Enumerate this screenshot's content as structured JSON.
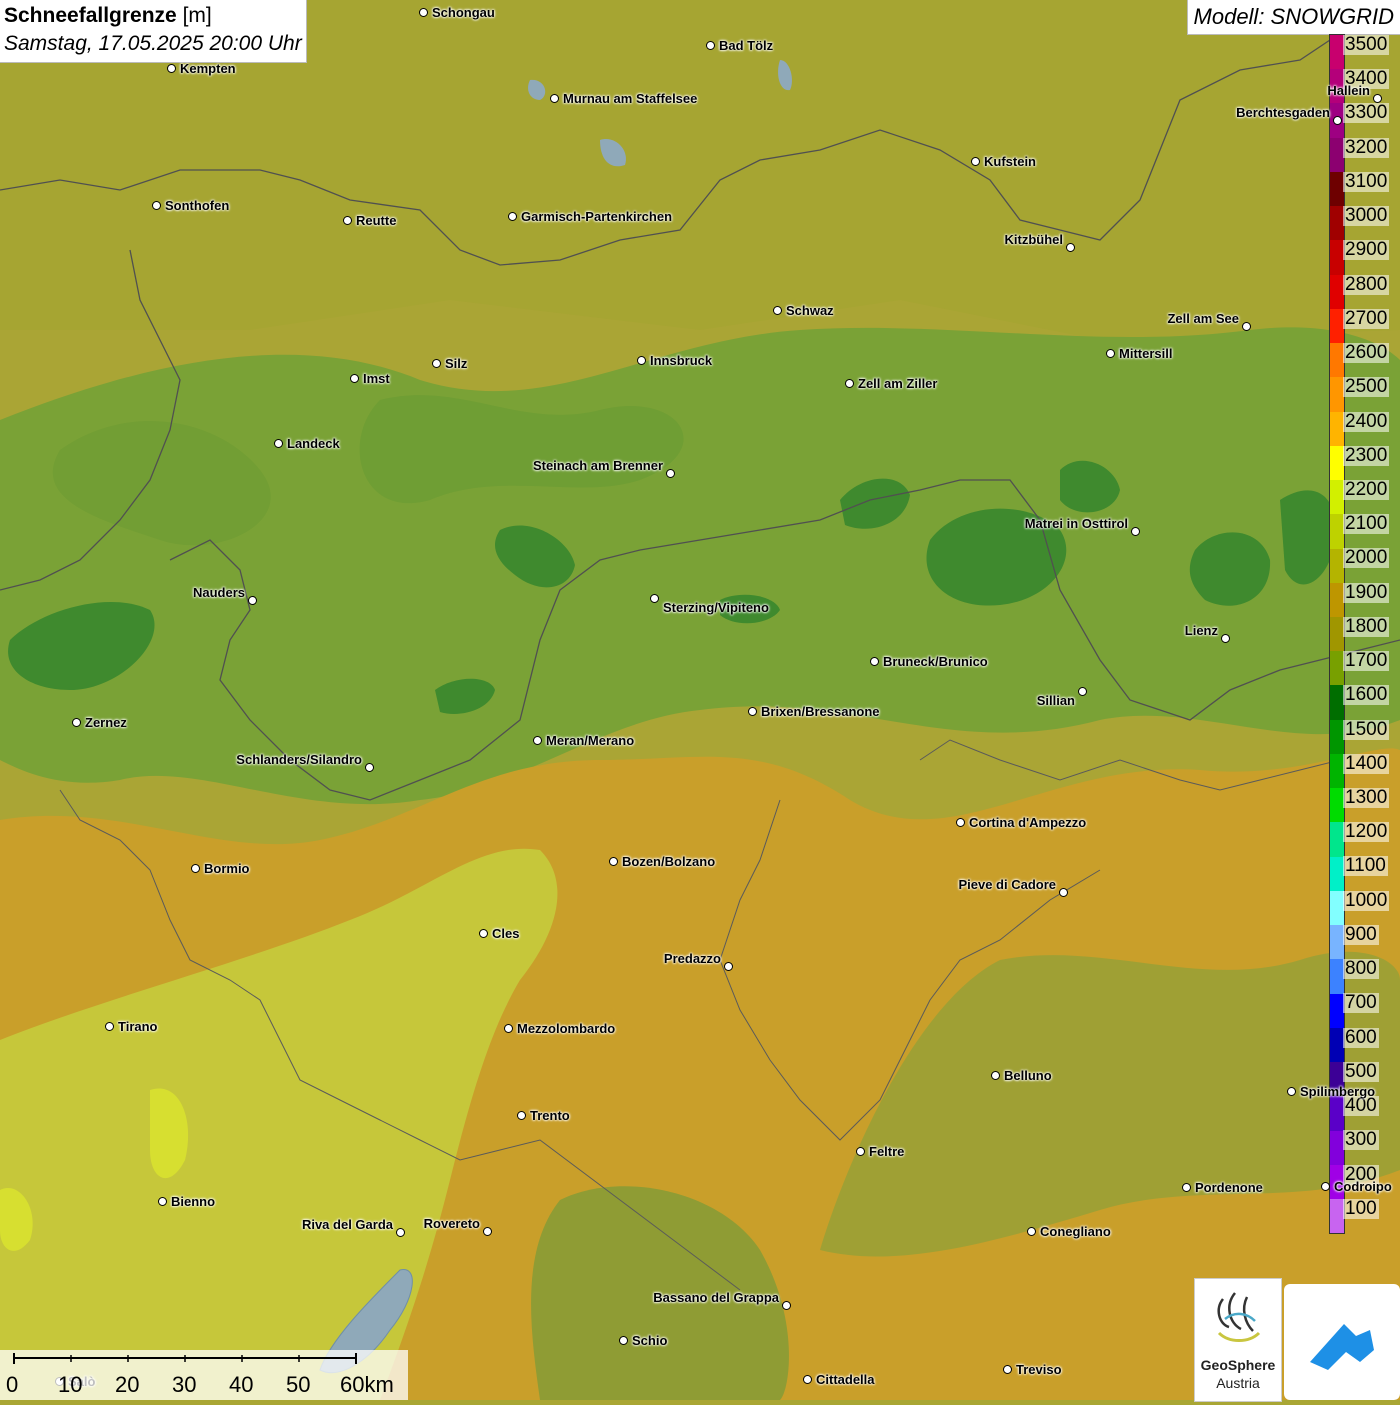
{
  "title": {
    "parameter": "Schneefallgrenze",
    "unit": "[m]",
    "datetime": "Samstag, 17.05.2025 20:00 Uhr"
  },
  "model": "Modell: SNOWGRID",
  "legend": {
    "levels": [
      "3500",
      "3400",
      "3300",
      "3200",
      "3100",
      "3000",
      "2900",
      "2800",
      "2700",
      "2600",
      "2500",
      "2400",
      "2300",
      "2200",
      "2100",
      "2000",
      "1900",
      "1800",
      "1700",
      "1600",
      "1500",
      "1400",
      "1300",
      "1200",
      "1100",
      "1000",
      "900",
      "800",
      "700",
      "600",
      "500",
      "400",
      "300",
      "200",
      "100"
    ],
    "colors": [
      "#c8006e",
      "#b4007a",
      "#9e0082",
      "#8c0070",
      "#6e0000",
      "#a00000",
      "#c80000",
      "#e00000",
      "#ff2000",
      "#ff7800",
      "#ff9600",
      "#ffb400",
      "#ffff00",
      "#d2f000",
      "#bed200",
      "#b4b400",
      "#be9600",
      "#a09600",
      "#78a000",
      "#006e00",
      "#009600",
      "#00b400",
      "#00dc00",
      "#00e68c",
      "#00f0c8",
      "#82ffff",
      "#78b4ff",
      "#3c82ff",
      "#0000ff",
      "#0000b4",
      "#3c0096",
      "#5a00c8",
      "#8200dc",
      "#a000e6",
      "#c864f0"
    ]
  },
  "cities": [
    {
      "name": "Schongau"
    },
    {
      "name": "Bad Tölz"
    },
    {
      "name": "Kempten"
    },
    {
      "name": "Murnau am Staffelsee"
    },
    {
      "name": "Hallein"
    },
    {
      "name": "Berchtesgaden"
    },
    {
      "name": "Kufstein"
    },
    {
      "name": "Sonthofen"
    },
    {
      "name": "Reutte"
    },
    {
      "name": "Garmisch-Partenkirchen"
    },
    {
      "name": "Kitzbühel"
    },
    {
      "name": "Schwaz"
    },
    {
      "name": "Zell am See"
    },
    {
      "name": "Innsbruck"
    },
    {
      "name": "Mittersill"
    },
    {
      "name": "Imst"
    },
    {
      "name": "Silz"
    },
    {
      "name": "Zell am Ziller"
    },
    {
      "name": "Landeck"
    },
    {
      "name": "Steinach am Brenner"
    },
    {
      "name": "Matrei in Osttirol"
    },
    {
      "name": "Nauders"
    },
    {
      "name": "Sterzing/Vipiteno"
    },
    {
      "name": "Lienz"
    },
    {
      "name": "Bruneck/Brunico"
    },
    {
      "name": "Sillian"
    },
    {
      "name": "Zernez"
    },
    {
      "name": "Brixen/Bressanone"
    },
    {
      "name": "Meran/Merano"
    },
    {
      "name": "Schlanders/Silandro"
    },
    {
      "name": "Cortina d'Ampezzo"
    },
    {
      "name": "Bozen/Bolzano"
    },
    {
      "name": "Bormio"
    },
    {
      "name": "Pieve di Cadore"
    },
    {
      "name": "Cles"
    },
    {
      "name": "Predazzo"
    },
    {
      "name": "Tirano"
    },
    {
      "name": "Mezzolombardo"
    },
    {
      "name": "Belluno"
    },
    {
      "name": "Spilimbergo"
    },
    {
      "name": "Trento"
    },
    {
      "name": "Feltre"
    },
    {
      "name": "Pordenone"
    },
    {
      "name": "Codroipo"
    },
    {
      "name": "Bienno"
    },
    {
      "name": "Riva del Garda"
    },
    {
      "name": "Rovereto"
    },
    {
      "name": "Conegliano"
    },
    {
      "name": "Bassano del Grappa"
    },
    {
      "name": "Schio"
    },
    {
      "name": "Treviso"
    },
    {
      "name": "Cittadella"
    },
    {
      "name": "Salò"
    }
  ],
  "scale": {
    "labels": [
      "0",
      "10",
      "20",
      "30",
      "40",
      "50",
      "60km"
    ]
  },
  "logos": {
    "geosphere_line1": "GeoSphere",
    "geosphere_line2": "Austria"
  }
}
